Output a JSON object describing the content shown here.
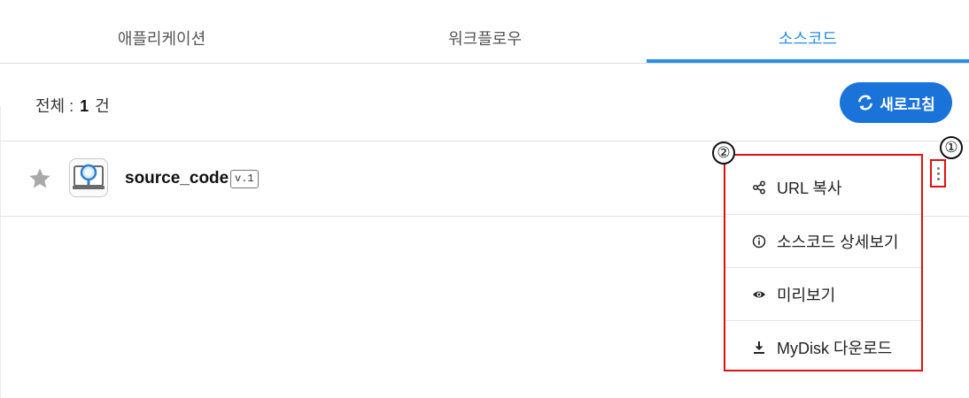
{
  "tabs": [
    {
      "label": "애플리케이션"
    },
    {
      "label": "워크플로우"
    },
    {
      "label": "소스코드",
      "active": true
    }
  ],
  "list": {
    "count_prefix": "전체 :",
    "count_value": "1",
    "count_suffix": "건"
  },
  "refresh_button": {
    "label": "새로고침",
    "icon": "refresh-icon"
  },
  "items": [
    {
      "name": "source_code",
      "version": "v.1",
      "icon": "app-magnifier-icon",
      "favorite": false
    }
  ],
  "context_menu": {
    "items": [
      {
        "label": "URL 복사",
        "icon": "share-icon"
      },
      {
        "label": "소스코드 상세보기",
        "icon": "info-icon"
      },
      {
        "label": "미리보기",
        "icon": "eye-icon"
      },
      {
        "label": "MyDisk 다운로드",
        "icon": "download-icon"
      }
    ]
  },
  "annotations": {
    "marker1": "①",
    "marker2": "②"
  },
  "colors": {
    "accent": "#2a8ee6",
    "button": "#1a73d9",
    "highlight": "#e01010"
  }
}
